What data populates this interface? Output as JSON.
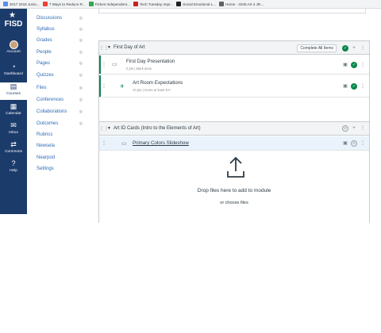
{
  "bookmarks": [
    {
      "label": "2017 2018 Junio...",
      "color": "#5b8def"
    },
    {
      "label": "7 Ways to Reduce R...",
      "color": "#e94235"
    },
    {
      "label": "Fishes Independent...",
      "color": "#34a853"
    },
    {
      "label": "Tech Tuesday Impr...",
      "color": "#c5221f"
    },
    {
      "label": "Social Emotional L...",
      "color": "#202124"
    },
    {
      "label": "Home · 3345 Art 4 JR...",
      "color": "#5f6368"
    }
  ],
  "global_nav": {
    "logo_text": "FISD",
    "items": [
      {
        "label": "Account",
        "icon": "avatar"
      },
      {
        "label": "Dashboard",
        "icon": "dashboard-icon"
      },
      {
        "label": "Courses",
        "icon": "courses-icon"
      },
      {
        "label": "Calendar",
        "icon": "calendar-icon"
      },
      {
        "label": "Inbox",
        "icon": "inbox-icon"
      },
      {
        "label": "Commons",
        "icon": "commons-icon"
      },
      {
        "label": "Help",
        "icon": "help-icon"
      }
    ]
  },
  "course_nav": {
    "items": [
      {
        "label": "Discussions",
        "hidden": true
      },
      {
        "label": "Syllabus",
        "hidden": true
      },
      {
        "label": "Grades",
        "hidden": true
      },
      {
        "label": "People",
        "hidden": true
      },
      {
        "label": "Pages",
        "hidden": true
      },
      {
        "label": "Quizzes",
        "hidden": true
      },
      {
        "label": "Files",
        "hidden": true
      },
      {
        "label": "Conferences",
        "hidden": true
      },
      {
        "label": "Collaborations",
        "hidden": true
      },
      {
        "label": "Outcomes",
        "hidden": true
      },
      {
        "label": "Rubrics",
        "hidden": false
      },
      {
        "label": "Newsela",
        "hidden": false
      },
      {
        "label": "Nearpod",
        "hidden": false
      },
      {
        "label": "Settings",
        "hidden": false
      }
    ]
  },
  "modules": {
    "first": {
      "title": "First Day of Art",
      "requirement_button": "Complete All Items",
      "items": [
        {
          "title": "First Day Presentation",
          "meta": "0 pts  |  Mark done",
          "icon": "page-icon"
        },
        {
          "title": "Art Room Expectations",
          "meta": "10 pts  |  Score at least 9.0",
          "icon": "quiz-icon"
        }
      ]
    },
    "second": {
      "title": "Art ID Cards (Intro to the Elements of Art)",
      "items": [
        {
          "title": "Primary Colors Slideshow",
          "icon": "page-icon"
        }
      ],
      "drop_text": "Drop files here to add to module",
      "drop_sub": "or choose files"
    }
  },
  "colors": {
    "global_nav_bg": "#1b3b6b",
    "link": "#2d6bb5",
    "published": "#0b874b"
  }
}
